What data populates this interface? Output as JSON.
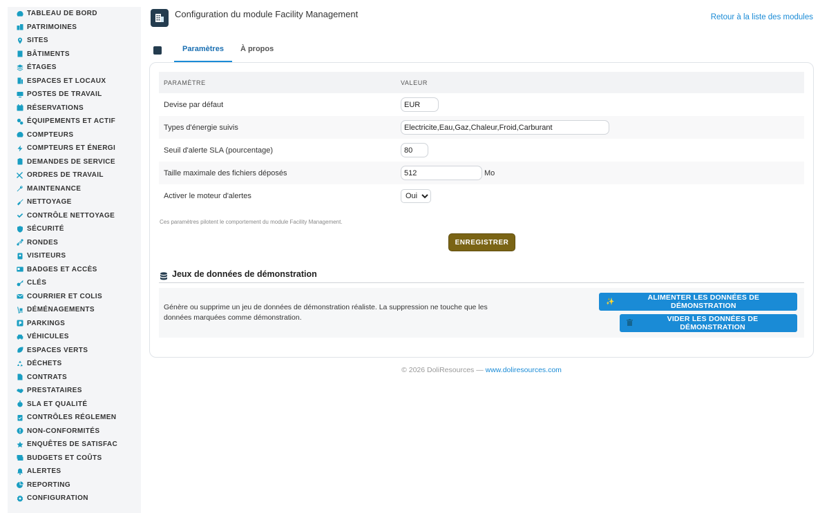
{
  "sidebar": {
    "icon_color": "#1a9ec2",
    "items": [
      {
        "label": "Tableau de bord",
        "icon": "gauge-icon"
      },
      {
        "label": "Patrimoines",
        "icon": "buildings-icon"
      },
      {
        "label": "Sites",
        "icon": "map-pin-icon"
      },
      {
        "label": "Bâtiments",
        "icon": "building-icon"
      },
      {
        "label": "Étages",
        "icon": "layers-icon"
      },
      {
        "label": "Espaces et locaux",
        "icon": "door-icon"
      },
      {
        "label": "Postes de travail",
        "icon": "monitor-icon"
      },
      {
        "label": "Réservations",
        "icon": "calendar-icon"
      },
      {
        "label": "Équipements et actif",
        "icon": "cogs-icon"
      },
      {
        "label": "Compteurs",
        "icon": "gauge-icon"
      },
      {
        "label": "Compteurs et énergi",
        "icon": "bolt-icon"
      },
      {
        "label": "Demandes de service",
        "icon": "clipboard-icon"
      },
      {
        "label": "Ordres de travail",
        "icon": "tools-icon"
      },
      {
        "label": "Maintenance",
        "icon": "wrench-icon"
      },
      {
        "label": "Nettoyage",
        "icon": "broom-icon"
      },
      {
        "label": "Contrôle nettoyage",
        "icon": "check-icon"
      },
      {
        "label": "Sécurité",
        "icon": "shield-icon"
      },
      {
        "label": "Rondes",
        "icon": "route-icon"
      },
      {
        "label": "Visiteurs",
        "icon": "id-badge-icon"
      },
      {
        "label": "Badges et accès",
        "icon": "id-card-icon"
      },
      {
        "label": "Clés",
        "icon": "key-icon"
      },
      {
        "label": "Courrier et colis",
        "icon": "envelope-icon"
      },
      {
        "label": "Déménagements",
        "icon": "dolly-icon"
      },
      {
        "label": "Parkings",
        "icon": "parking-icon"
      },
      {
        "label": "Véhicules",
        "icon": "car-icon"
      },
      {
        "label": "Espaces verts",
        "icon": "leaf-icon"
      },
      {
        "label": "Déchets",
        "icon": "recycle-icon"
      },
      {
        "label": "Contrats",
        "icon": "file-icon"
      },
      {
        "label": "Prestataires",
        "icon": "handshake-icon"
      },
      {
        "label": "SLA et qualité",
        "icon": "stopwatch-icon"
      },
      {
        "label": "Contrôles réglemen",
        "icon": "clipboard-check-icon"
      },
      {
        "label": "Non-conformités",
        "icon": "exclamation-icon"
      },
      {
        "label": "Enquêtes de satisfac",
        "icon": "star-icon"
      },
      {
        "label": "Budgets et coûts",
        "icon": "money-icon"
      },
      {
        "label": "Alertes",
        "icon": "bell-icon"
      },
      {
        "label": "Reporting",
        "icon": "chart-pie-icon"
      },
      {
        "label": "Configuration",
        "icon": "gear-icon"
      }
    ]
  },
  "header": {
    "title": "Configuration du module Facility Management",
    "back_link": "Retour à la liste des modules",
    "logo_color": "#243c4f"
  },
  "tabs": [
    {
      "label": "Paramètres",
      "active": true
    },
    {
      "label": "À propos",
      "active": false
    }
  ],
  "params": {
    "col_param": "Paramètre",
    "col_value": "Valeur",
    "rows": [
      {
        "label": "Devise par défaut",
        "value": "EUR"
      },
      {
        "label": "Types d'énergie suivis",
        "value": "Electricite,Eau,Gaz,Chaleur,Froid,Carburant"
      },
      {
        "label": "Seuil d'alerte SLA (pourcentage)",
        "value": "80"
      },
      {
        "label": "Taille maximale des fichiers déposés",
        "value": "512",
        "unit": "Mo"
      },
      {
        "label": "Activer le moteur d'alertes",
        "value": "Oui"
      }
    ],
    "note": "Ces paramètres pilotent le comportement du module Facility Management.",
    "save_label": "ENREGISTRER",
    "save_color": "#7a6415"
  },
  "demo": {
    "title": "Jeux de données de démonstration",
    "description": "Génère ou supprime un jeu de données de démonstration réaliste. La suppression ne touche que les données marquées comme démonstration.",
    "seed_label": "ALIMENTER LES DONNÉES DE DÉMONSTRATION",
    "clear_label": "VIDER LES DONNÉES DE DÉMONSTRATION",
    "button_color": "#1a8bd6"
  },
  "footer": {
    "copyright": "© 2026 DoliResources — ",
    "link": "www.doliresources.com"
  }
}
